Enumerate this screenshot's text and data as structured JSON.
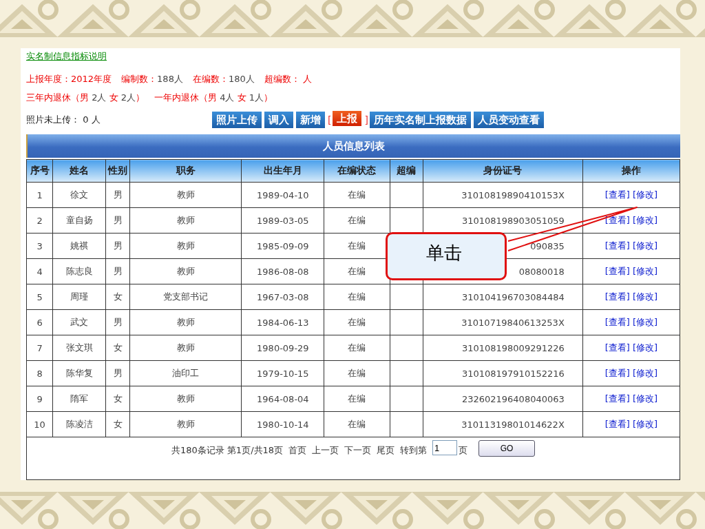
{
  "info_link": "实名制信息指标说明",
  "stats": [
    {
      "label": "上报年度：",
      "value": "2012年度",
      "highlight": true
    },
    {
      "label": "编制数：",
      "value": "188人",
      "highlight": false
    },
    {
      "label": "在编数：",
      "value": "180人",
      "highlight": false
    },
    {
      "label": "超编数：",
      "value": " 人",
      "highlight": true
    }
  ],
  "retire": [
    {
      "label": "三年内退休（",
      "male": "男",
      "male_count": "2人",
      "female": "女",
      "female_count": "2人",
      "close": "）"
    },
    {
      "label": "一年内退休（",
      "male": "男",
      "male_count": "4人",
      "female": "女",
      "female_count": "1人",
      "close": "）"
    }
  ],
  "photo_note": {
    "label": "照片未上传：",
    "value": "0 人"
  },
  "buttons": [
    {
      "label": "照片上传",
      "kind": "blue"
    },
    {
      "label": "调入",
      "kind": "blue"
    },
    {
      "label": "新增",
      "kind": "blue"
    },
    {
      "label": "上报",
      "kind": "orange",
      "bracket_open": "[",
      "bracket_close": "]"
    },
    {
      "label": "历年实名制上报数据",
      "kind": "blue"
    },
    {
      "label": "人员变动查看",
      "kind": "blue"
    }
  ],
  "list_title": "人员信息列表",
  "table": {
    "columns": [
      "序号",
      "姓名",
      "性别",
      "职务",
      "出生年月",
      "在编状态",
      "超编",
      "身份证号",
      "操作"
    ],
    "rows": [
      {
        "no": "1",
        "name": "徐文",
        "sex": "男",
        "job": "教师",
        "birth": "1989-04-10",
        "status": "在编",
        "over": "",
        "id": "31010819890410153X",
        "view": "[查看]",
        "edit": "[修改]"
      },
      {
        "no": "2",
        "name": "童自扬",
        "sex": "男",
        "job": "教师",
        "birth": "1989-03-05",
        "status": "在编",
        "over": "",
        "id": "310108198903051059",
        "view": "[查看]",
        "edit": "[修改]"
      },
      {
        "no": "3",
        "name": "姚祺",
        "sex": "男",
        "job": "教师",
        "birth": "1985-09-09",
        "status": "在编",
        "over": "",
        "id": "090835",
        "view": "[查看]",
        "edit": "[修改]"
      },
      {
        "no": "4",
        "name": "陈志良",
        "sex": "男",
        "job": "教师",
        "birth": "1986-08-08",
        "status": "在编",
        "over": "",
        "id": "08080018",
        "view": "[查看]",
        "edit": "[修改]"
      },
      {
        "no": "5",
        "name": "周瑾",
        "sex": "女",
        "job": "党支部书记",
        "birth": "1967-03-08",
        "status": "在编",
        "over": "",
        "id": "310104196703084484",
        "view": "[查看]",
        "edit": "[修改]"
      },
      {
        "no": "6",
        "name": "武文",
        "sex": "男",
        "job": "教师",
        "birth": "1984-06-13",
        "status": "在编",
        "over": "",
        "id": "31010719840613253X",
        "view": "[查看]",
        "edit": "[修改]"
      },
      {
        "no": "7",
        "name": "张文琪",
        "sex": "女",
        "job": "教师",
        "birth": "1980-09-29",
        "status": "在编",
        "over": "",
        "id": "310108198009291226",
        "view": "[查看]",
        "edit": "[修改]"
      },
      {
        "no": "8",
        "name": "陈华复",
        "sex": "男",
        "job": "油印工",
        "birth": "1979-10-15",
        "status": "在编",
        "over": "",
        "id": "310108197910152216",
        "view": "[查看]",
        "edit": "[修改]"
      },
      {
        "no": "9",
        "name": "隋军",
        "sex": "女",
        "job": "教师",
        "birth": "1964-08-04",
        "status": "在编",
        "over": "",
        "id": "232602196408040063",
        "view": "[查看]",
        "edit": "[修改]"
      },
      {
        "no": "10",
        "name": "陈凌洁",
        "sex": "女",
        "job": "教师",
        "birth": "1980-10-14",
        "status": "在编",
        "over": "",
        "id": "31011319801014622X",
        "view": "[查看]",
        "edit": "[修改]"
      }
    ]
  },
  "pagination": {
    "summary": "共180条记录 第1页/共18页",
    "links": [
      "首页",
      "上一页",
      "下一页",
      "尾页"
    ],
    "goto_label": "转到第",
    "page_value": "1",
    "page_suffix": "页",
    "go": "GO"
  },
  "callout": "单击"
}
